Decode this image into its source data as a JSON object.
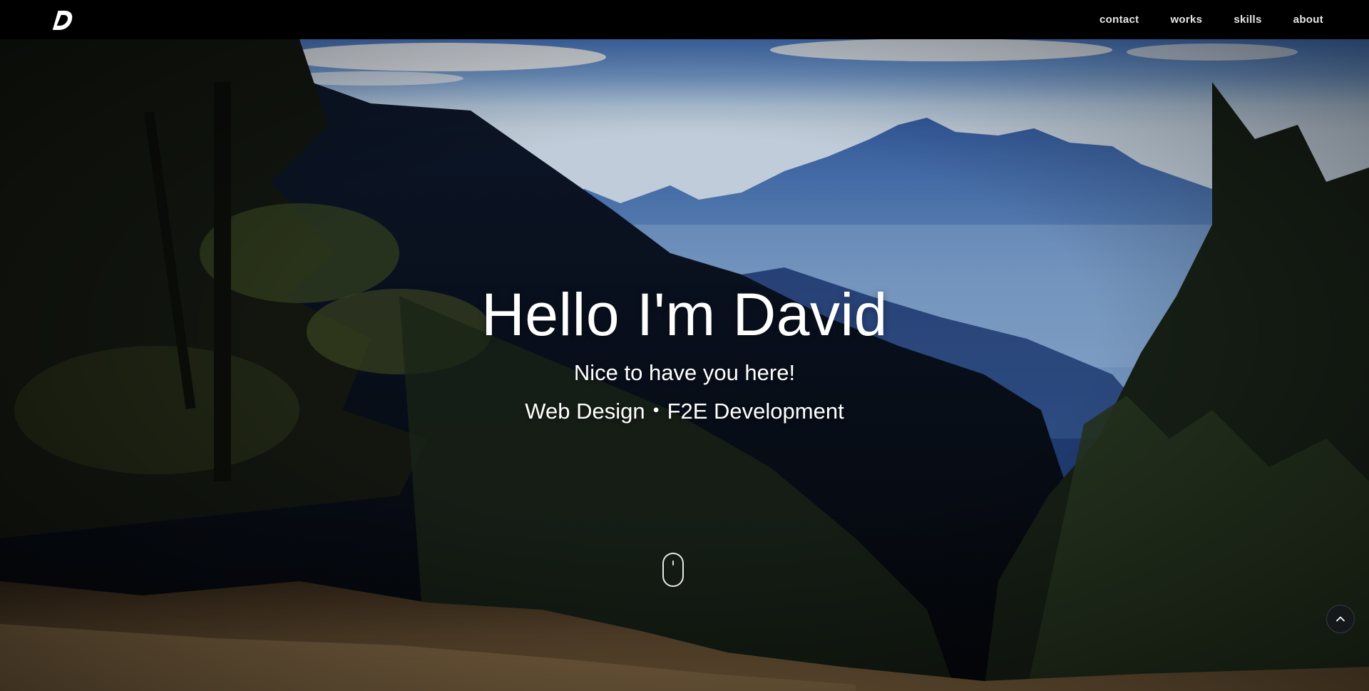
{
  "nav": {
    "logo_letter": "D",
    "links": [
      {
        "label": "contact"
      },
      {
        "label": "works"
      },
      {
        "label": "skills"
      },
      {
        "label": "about"
      }
    ]
  },
  "hero": {
    "title": "Hello I'm David",
    "subtitle": "Nice to have you here!",
    "tagline": "Web Design・F2E Development",
    "background_image": "mountain-forest-landscape"
  },
  "icons": {
    "scroll": "mouse-scroll-icon",
    "back_to_top": "chevron-up-icon",
    "logo": "d-logo-icon"
  },
  "colors": {
    "nav_bg": "#000000",
    "text": "#ffffff",
    "sky": "#8fb6e6"
  }
}
